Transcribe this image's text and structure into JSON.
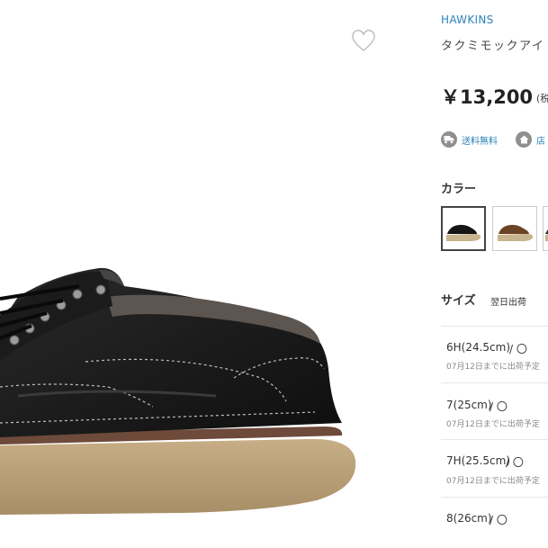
{
  "brand": "HAWKINS",
  "product": {
    "name": "タクミモックアイ"
  },
  "price": {
    "value": "￥13,200",
    "tax": "(税"
  },
  "tags": [
    {
      "icon": "truck-icon",
      "label": "送料無料"
    },
    {
      "icon": "home-icon",
      "label": "店"
    }
  ],
  "color": {
    "label": "カラー",
    "selected_index": 0
  },
  "size": {
    "label": "サイズ",
    "sub": "翌日出荷",
    "rows": [
      {
        "size": "6H(24.5cm)",
        "stock": "/ 〇",
        "note": "07月12日までに出荷予定"
      },
      {
        "size": "7(25cm)",
        "stock": "/ 〇",
        "note": "07月12日までに出荷予定"
      },
      {
        "size": "7H(25.5cm)",
        "stock": "/ 〇",
        "note": "07月12日までに出荷予定"
      },
      {
        "size": "8(26cm)",
        "stock": "/ 〇",
        "note": ""
      }
    ]
  },
  "colors": {
    "link": "#2b83b9",
    "price": "#222222",
    "icon_bg": "#8f8f8f"
  }
}
